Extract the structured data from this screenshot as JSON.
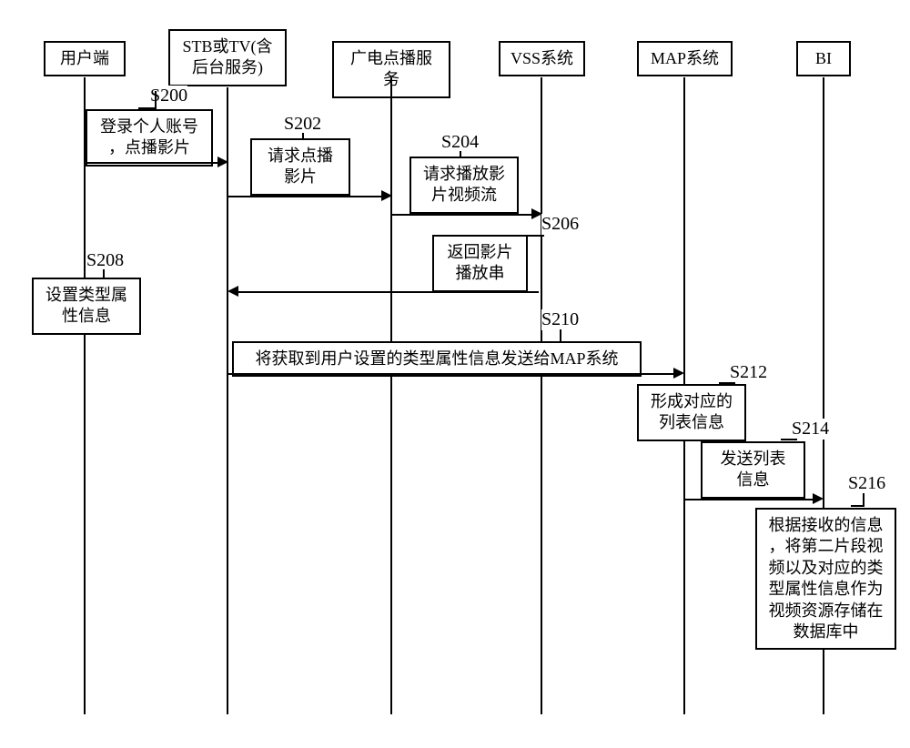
{
  "participants": {
    "p1": "用户端",
    "p2": "STB或TV(含\n后台服务)",
    "p3": "广电点播服务",
    "p4": "VSS系统",
    "p5": "MAP系统",
    "p6": "BI"
  },
  "steps": {
    "s200": {
      "label": "S200",
      "text": "登录个人账号\n，点播影片"
    },
    "s202": {
      "label": "S202",
      "text": "请求点播\n影片"
    },
    "s204": {
      "label": "S204",
      "text": "请求播放影\n片视频流"
    },
    "s206": {
      "label": "S206",
      "text": "返回影片\n播放串"
    },
    "s208": {
      "label": "S208",
      "text": "设置类型属\n性信息"
    },
    "s210": {
      "label": "S210",
      "text": "将获取到用户设置的类型属性信息发送给MAP系统"
    },
    "s212": {
      "label": "S212",
      "text": "形成对应的\n列表信息"
    },
    "s214": {
      "label": "S214",
      "text": "发送列表\n信息"
    },
    "s216": {
      "label": "S216",
      "text": "根据接收的信息\n，将第二片段视\n频以及对应的类\n型属性信息作为\n视频资源存储在\n数据库中"
    }
  }
}
